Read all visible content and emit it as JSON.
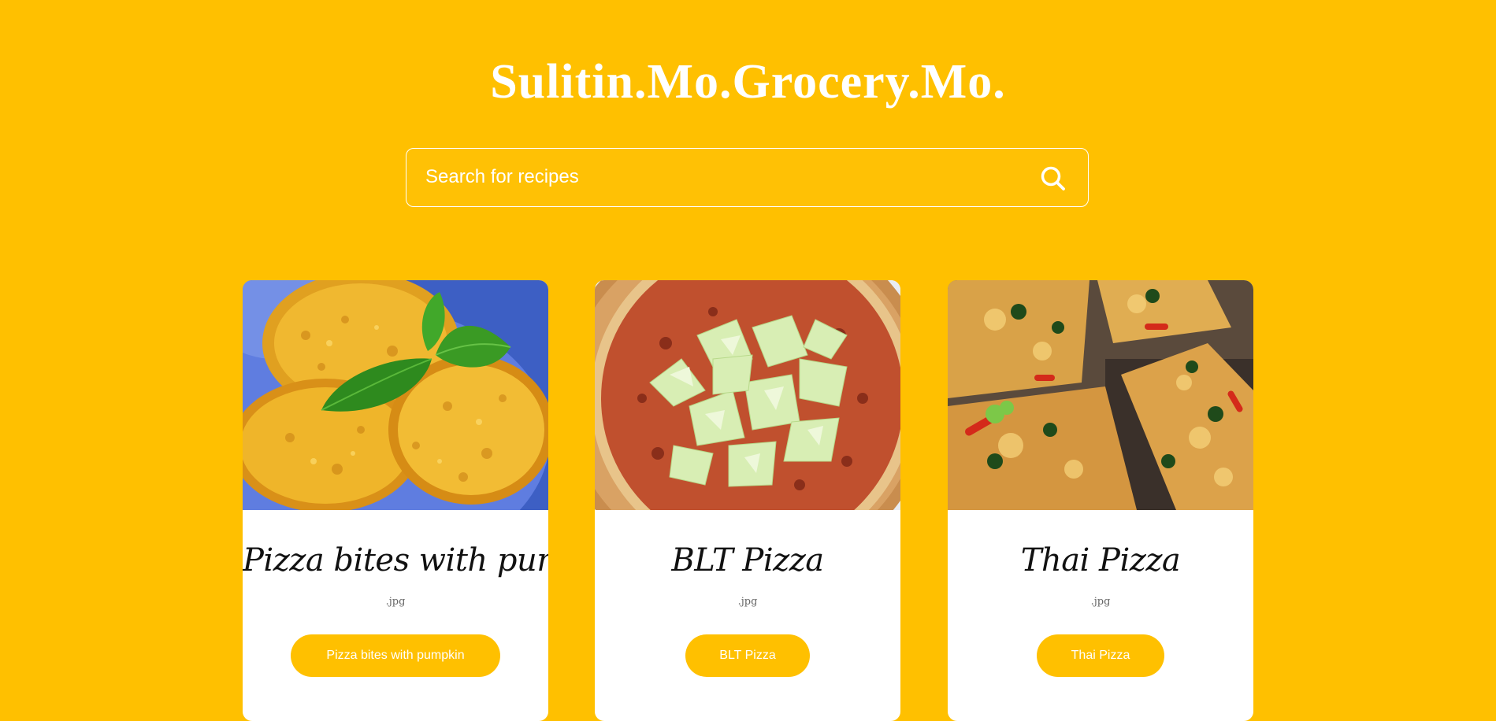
{
  "header": {
    "title": "Sulitin.Mo.Grocery.Mo."
  },
  "search": {
    "placeholder": "Search for recipes",
    "value": "",
    "icon": "search-icon"
  },
  "recipes": [
    {
      "title": "Pizza bites with pumpkin",
      "meta": ".jpg",
      "button_label": "Pizza bites with pumpkin"
    },
    {
      "title": "BLT Pizza",
      "meta": ".jpg",
      "button_label": "BLT Pizza"
    },
    {
      "title": "Thai Pizza",
      "meta": ".jpg",
      "button_label": "Thai Pizza"
    }
  ],
  "colors": {
    "background": "#ffc000",
    "card": "#ffffff",
    "button": "#ffc000",
    "title_text": "#ffffff",
    "card_title_text": "#111111"
  }
}
